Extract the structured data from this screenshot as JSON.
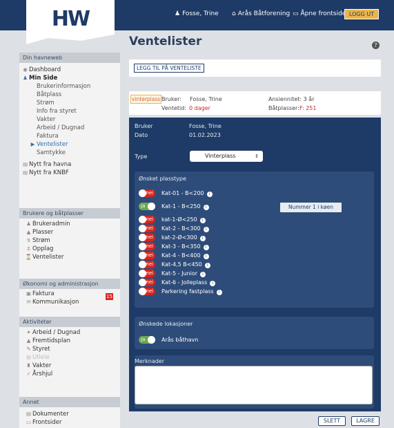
{
  "header": {
    "logo": "HW",
    "user_name": "Fosse, Trine",
    "org_name": "Arås Båtforening",
    "open_front": "Åpne frontsider",
    "logout": "LOGG UT"
  },
  "sidebar": {
    "sec1": "Din havneweb",
    "dashboard": "Dashboard",
    "min_side": "Min Side",
    "brukerinfo": "Brukerinformasjon",
    "batplass": "Båtplass",
    "strom": "Strøm",
    "info_styret": "Info fra styret",
    "vakter": "Vakter",
    "arbeid": "Arbeid / Dugnad",
    "faktura1": "Faktura",
    "ventelister": "Ventelister",
    "samtykke": "Samtykke",
    "nytt_havna": "Nytt fra havna",
    "nytt_knbf": "Nytt fra KNBF",
    "sec2": "Brukere og båtplasser",
    "brukeradmin": "Brukeradmin",
    "plasser": "Plasser",
    "strom2": "Strøm",
    "opplag": "Opplag",
    "ventelister2": "Ventelister",
    "sec3": "Økonomi og administrasjon",
    "faktura2": "Faktura",
    "faktura_badge": "15",
    "kommunikasjon": "Kommunikasjon",
    "sec4": "Aktiviteter",
    "arbeid2": "Arbeid / Dugnad",
    "fremtidsplan": "Fremtidsplan",
    "styret": "Styret",
    "utleie": "Utleie",
    "vakter2": "Vakter",
    "arshjul": "Årshjul",
    "sec5": "Annet",
    "dokumenter": "Dokumenter",
    "frontsider": "Frontsider"
  },
  "main": {
    "title": "Ventelister",
    "help": "?",
    "add_button": "LEGG TIL PÅ VENTELISTE",
    "summary": {
      "badge": "vinterplass",
      "bruker_label": "Bruker:",
      "bruker_value": "Fosse, Trine",
      "ventetid_label": "Ventetid:",
      "ventetid_value": "0 dager",
      "ansiennitet": "Ansiennitet: 3 år",
      "batplasser_label": "Båtplasser:",
      "batplasser_value": "F: 251"
    },
    "form": {
      "bruker_label": "Bruker",
      "bruker_value": "Fosse, Trine",
      "dato_label": "Dato",
      "dato_value": "01.02.2023",
      "type_label": "Type",
      "type_value": "Vinterplass",
      "plasstype_header": "Ønsket plasstype",
      "queue_button": "Nummer 1 i køen",
      "toggle_on_text": "ja",
      "toggle_off_text": "nei",
      "info_glyph": "i",
      "categories": [
        {
          "label": "Kat-01 - B<200",
          "on": false,
          "info": true
        },
        {
          "label": "Kat-1 - B<250",
          "on": true,
          "info": true
        },
        {
          "label": "kat-1-Ø<250",
          "on": false,
          "info": true
        },
        {
          "label": "Kat-2 - B<300",
          "on": false,
          "info": true
        },
        {
          "label": "kat-2-Ø<300",
          "on": false,
          "info": true
        },
        {
          "label": "Kat-3 - B<350",
          "on": false,
          "info": true
        },
        {
          "label": "Kat-4 - B<400",
          "on": false,
          "info": true
        },
        {
          "label": "Kat-4,5 B<450",
          "on": false,
          "info": true
        },
        {
          "label": "Kat-5 - Junior",
          "on": false,
          "info": true
        },
        {
          "label": "Kat-6 - Jolleplass",
          "on": false,
          "info": true
        },
        {
          "label": "Parkering fastplass",
          "on": false,
          "info": true
        }
      ],
      "lokasjoner_header": "Ønskede lokasjoner",
      "lokasjon": {
        "label": "Arås båthavn",
        "on": true
      },
      "merknader_label": "Merknader",
      "merknader_value": ""
    },
    "delete_button": "SLETT",
    "save_button": "LAGRE"
  },
  "colors": {
    "navy": "#1e3a66",
    "subpanel": "#2e4c79",
    "accent_orange": "#e9b54a",
    "toggle_off": "#d6261f",
    "toggle_on": "#6aa84f",
    "link_blue": "#2c6fb0"
  },
  "icons": {
    "user": "user-icon",
    "home": "home-icon",
    "monitor": "monitor-icon"
  }
}
